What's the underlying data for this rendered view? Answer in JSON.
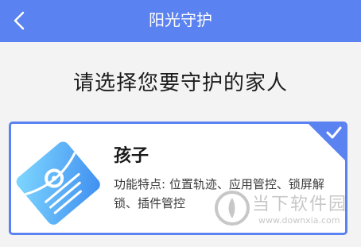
{
  "header": {
    "title": "阳光守护",
    "background_color": "#5a82f0",
    "back_icon": "chevron-left-icon"
  },
  "main": {
    "prompt": "请选择您要守护的家人",
    "cards": [
      {
        "title": "孩子",
        "description": "功能特点: 位置轨迹、应用管控、锁屏解锁、插件管控",
        "selected": true,
        "icon": "child-protection-icon",
        "accent_color": "#5a82f0"
      }
    ]
  },
  "watermark": {
    "brand": "当下软件园",
    "url": "www.downxia.com"
  }
}
